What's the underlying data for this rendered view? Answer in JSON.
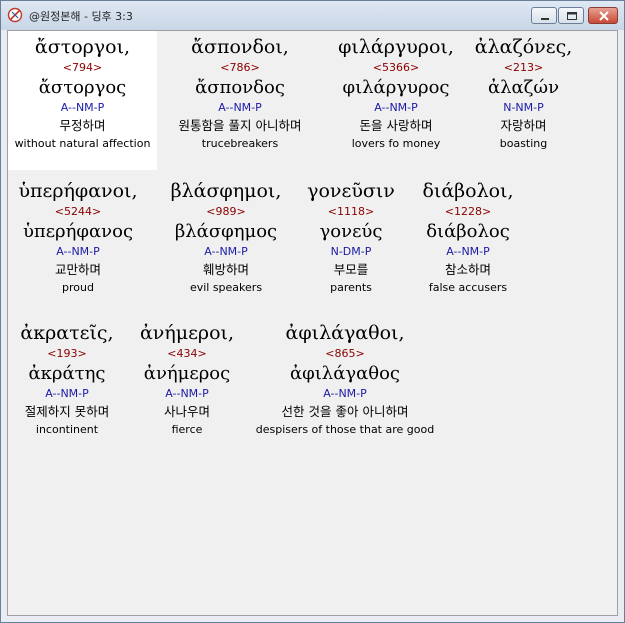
{
  "window": {
    "title": "@원정본해 - 딩후 3:3"
  },
  "words": [
    {
      "greek": "ἄστοργοι,",
      "strongs": "<794>",
      "lemma": "ἄστοργος",
      "parse": "A--NM-P",
      "korean": "무정하며",
      "english": "without natural affection"
    },
    {
      "greek": "ἄσπονδοι,",
      "strongs": "<786>",
      "lemma": "ἄσπονδος",
      "parse": "A--NM-P",
      "korean": "원통함을 풀지 아니하며",
      "english": "trucebreakers"
    },
    {
      "greek": "φιλάργυροι,",
      "strongs": "<5366>",
      "lemma": "φιλάργυρος",
      "parse": "A--NM-P",
      "korean": "돈을 사랑하며",
      "english": "lovers fo money"
    },
    {
      "greek": "ἀλαζόνες,",
      "strongs": "<213>",
      "lemma": "ἀλαζών",
      "parse": "N-NM-P",
      "korean": "자랑하며",
      "english": "boasting"
    },
    {
      "greek": "ὑπερήφανοι,",
      "strongs": "<5244>",
      "lemma": "ὑπερήφανος",
      "parse": "A--NM-P",
      "korean": "교만하며",
      "english": "proud"
    },
    {
      "greek": "βλάσφημοι,",
      "strongs": "<989>",
      "lemma": "βλάσφημος",
      "parse": "A--NM-P",
      "korean": "훼방하며",
      "english": "evil speakers"
    },
    {
      "greek": "γονεῦσιν",
      "strongs": "<1118>",
      "lemma": "γονεύς",
      "parse": "N-DM-P",
      "korean": "부모를",
      "english": "parents"
    },
    {
      "greek": "διάβολοι,",
      "strongs": "<1228>",
      "lemma": "διάβολος",
      "parse": "A--NM-P",
      "korean": "참소하며",
      "english": "false accusers"
    },
    {
      "greek": "ἀκρατεῖς,",
      "strongs": "<193>",
      "lemma": "ἀκράτης",
      "parse": "A--NM-P",
      "korean": "절제하지 못하며",
      "english": "incontinent"
    },
    {
      "greek": "ἀνήμεροι,",
      "strongs": "<434>",
      "lemma": "ἀνήμερος",
      "parse": "A--NM-P",
      "korean": "사나우며",
      "english": "fierce"
    },
    {
      "greek": "ἀφιλάγαθοι,",
      "strongs": "<865>",
      "lemma": "ἀφιλάγαθος",
      "parse": "A--NM-P",
      "korean": "선한 것을 좋아 아니하며",
      "english": "despisers of those that are good"
    }
  ]
}
